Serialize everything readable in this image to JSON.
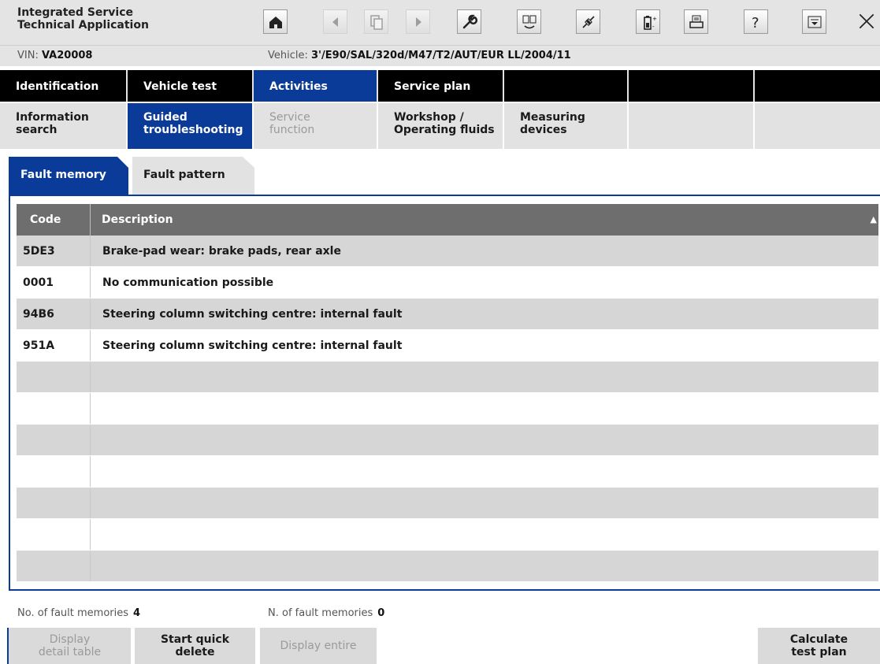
{
  "app": {
    "title_line1": "Integrated Service",
    "title_line2": "Technical Application"
  },
  "toolbar": {
    "buttons": [
      {
        "icon": "home-icon",
        "enabled": true
      },
      {
        "icon": "back-icon",
        "enabled": false
      },
      {
        "icon": "document-icon",
        "enabled": false
      },
      {
        "icon": "forward-icon",
        "enabled": false
      },
      {
        "icon": "wrench-icon",
        "enabled": true
      },
      {
        "icon": "transfer-icon",
        "enabled": true
      },
      {
        "icon": "connection-icon",
        "enabled": true
      },
      {
        "icon": "battery-icon",
        "enabled": true
      },
      {
        "icon": "print-icon",
        "enabled": true
      },
      {
        "icon": "help-icon",
        "enabled": true
      },
      {
        "icon": "minimize-icon",
        "enabled": true
      },
      {
        "icon": "close-icon",
        "enabled": true
      }
    ]
  },
  "info": {
    "vin_label": "VIN:",
    "vin_value": "VA20008",
    "vehicle_label": "Vehicle:",
    "vehicle_value": "3'/E90/SAL/320d/M47/T2/AUT/EUR LL/2004/11"
  },
  "main_nav": [
    {
      "label": "Identification",
      "active": false
    },
    {
      "label": "Vehicle test",
      "active": false
    },
    {
      "label": "Activities",
      "active": true
    },
    {
      "label": "Service plan",
      "active": false
    },
    {
      "label": "",
      "active": false
    },
    {
      "label": "",
      "active": false
    },
    {
      "label": "",
      "active": false
    }
  ],
  "sub_nav": [
    {
      "line1": "Information",
      "line2": "search",
      "state": "normal"
    },
    {
      "line1": "Guided",
      "line2": "troubleshooting",
      "state": "active"
    },
    {
      "line1": "Service",
      "line2": "function",
      "state": "disabled"
    },
    {
      "line1": "Workshop /",
      "line2": "Operating fluids",
      "state": "normal"
    },
    {
      "line1": "Measuring",
      "line2": "devices",
      "state": "normal"
    },
    {
      "line1": "",
      "line2": "",
      "state": "normal"
    },
    {
      "line1": "",
      "line2": "",
      "state": "normal"
    }
  ],
  "tabs": {
    "fault_memory": "Fault memory",
    "fault_pattern": "Fault pattern"
  },
  "table": {
    "col_code": "Code",
    "col_description": "Description",
    "sort_indicator": "▲",
    "rows": [
      {
        "code": "5DE3",
        "description": "Brake-pad wear: brake pads, rear axle"
      },
      {
        "code": "0001",
        "description": "No communication possible"
      },
      {
        "code": "94B6",
        "description": "Steering column switching centre: internal fault"
      },
      {
        "code": "951A",
        "description": "Steering column switching centre: internal fault"
      },
      {
        "code": "",
        "description": ""
      },
      {
        "code": "",
        "description": ""
      },
      {
        "code": "",
        "description": ""
      },
      {
        "code": "",
        "description": ""
      },
      {
        "code": "",
        "description": ""
      },
      {
        "code": "",
        "description": ""
      },
      {
        "code": "",
        "description": ""
      }
    ]
  },
  "footer": {
    "count1_label": "No. of fault memories",
    "count1_value": "4",
    "count2_label": "N. of fault memories",
    "count2_value": "0",
    "btn_display_detail_line1": "Display",
    "btn_display_detail_line2": "detail table",
    "btn_quick_delete_line1": "Start quick",
    "btn_quick_delete_line2": "delete",
    "btn_display_entire": "Display entire",
    "btn_calc_line1": "Calculate",
    "btn_calc_line2": "test plan"
  },
  "colors": {
    "accent": "#0a3b99",
    "nav_bg": "#000000",
    "header_row": "#6e6e6e",
    "row_shade": "#d6d6d6",
    "chrome": "#e4e4e4"
  }
}
